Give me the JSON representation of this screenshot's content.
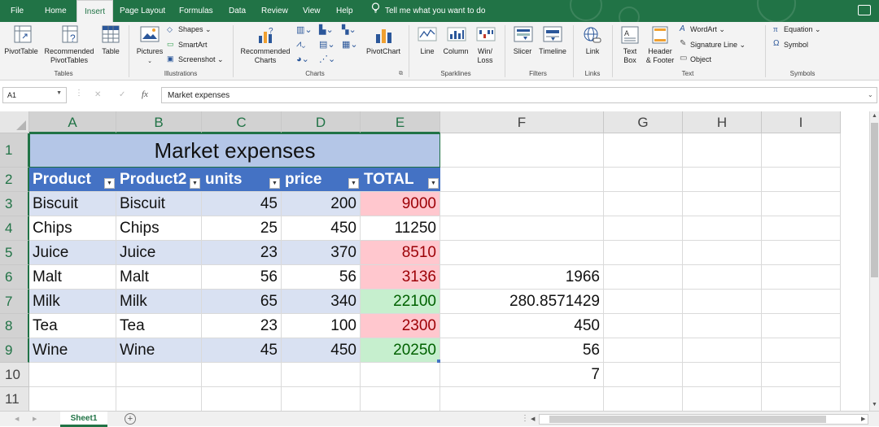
{
  "menu": [
    "File",
    "Home",
    "Insert",
    "Page Layout",
    "Formulas",
    "Data",
    "Review",
    "View",
    "Help"
  ],
  "active_menu": "Insert",
  "tell_me": "Tell me what you want to do",
  "ribbon": {
    "groups": [
      "Tables",
      "Illustrations",
      "Charts",
      "Sparklines",
      "Filters",
      "Links",
      "Text",
      "Symbols"
    ],
    "pivot_table": "PivotTable",
    "recommended_pt_1": "Recommended",
    "recommended_pt_2": "PivotTables",
    "table": "Table",
    "pictures": "Pictures",
    "shapes": "Shapes",
    "smartart": "SmartArt",
    "screenshot": "Screenshot",
    "rec_charts_1": "Recommended",
    "rec_charts_2": "Charts",
    "pivot_chart": "PivotChart",
    "line": "Line",
    "column": "Column",
    "winloss_1": "Win/",
    "winloss_2": "Loss",
    "slicer": "Slicer",
    "timeline": "Timeline",
    "link": "Link",
    "textbox_1": "Text",
    "textbox_2": "Box",
    "header_footer_1": "Header",
    "header_footer_2": "& Footer",
    "wordart": "WordArt",
    "signature_line": "Signature Line",
    "object": "Object",
    "equation": "Equation",
    "symbol": "Symbol"
  },
  "formula_bar": {
    "name_box": "A1",
    "fx": "fx",
    "content": "Market expenses"
  },
  "columns": [
    "A",
    "B",
    "C",
    "D",
    "E",
    "F",
    "G",
    "H",
    "I"
  ],
  "rows": [
    "1",
    "2",
    "3",
    "4",
    "5",
    "6",
    "7",
    "8",
    "9",
    "10",
    "11"
  ],
  "title": "Market expenses",
  "headers": [
    "Product",
    "Product2",
    "units",
    "price",
    "TOTAL"
  ],
  "data": [
    [
      " Biscuit",
      "Biscuit",
      "45",
      "200",
      "9000"
    ],
    [
      "Chips",
      "Chips",
      "25",
      "450",
      "11250"
    ],
    [
      "Juice",
      "Juice",
      "23",
      "370",
      "8510"
    ],
    [
      " Malt",
      "Malt",
      "56",
      "56",
      "3136"
    ],
    [
      "Milk",
      "Milk",
      "65",
      "340",
      "22100"
    ],
    [
      "Tea",
      "Tea",
      "23",
      "100",
      "2300"
    ],
    [
      "Wine",
      "Wine",
      "45",
      "450",
      "20250"
    ]
  ],
  "total_highlight": [
    "red",
    "none",
    "red",
    "red",
    "green",
    "red",
    "green"
  ],
  "f_column": [
    {
      "row": 6,
      "value": "1966"
    },
    {
      "row": 7,
      "value": "280.8571429"
    },
    {
      "row": 8,
      "value": "450"
    },
    {
      "row": 9,
      "value": "56"
    },
    {
      "row": 10,
      "value": "7"
    }
  ],
  "sheet_tab": "Sheet1",
  "colors": {
    "excel_green": "#217346",
    "table_header": "#4472c4",
    "band": "#d9e1f2",
    "bad_fill": "#ffc7ce",
    "good_fill": "#c6efce"
  }
}
